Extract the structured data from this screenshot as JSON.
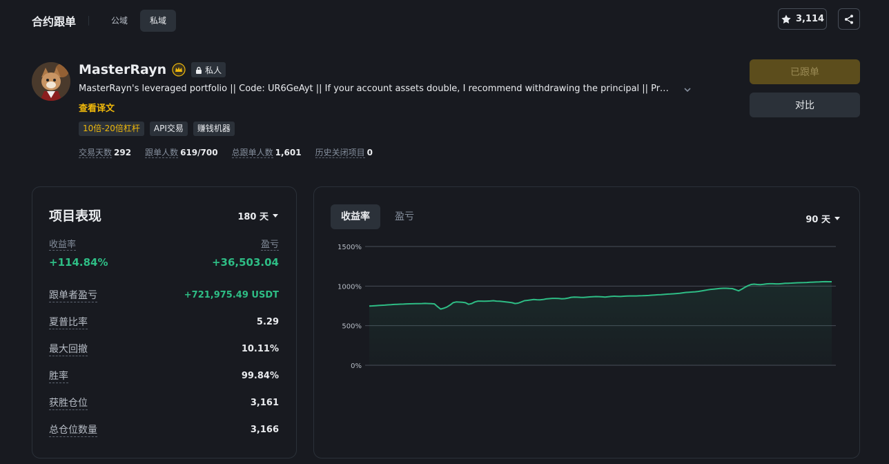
{
  "header": {
    "title": "合约跟单",
    "tabs": [
      {
        "label": "公域",
        "active": false
      },
      {
        "label": "私域",
        "active": true
      }
    ],
    "favorite_count": "3,114"
  },
  "profile": {
    "name": "MasterRayn",
    "private_label": "私人",
    "description": "MasterRayn's leveraged portfolio || Code: UR6GeAyt || If your account assets double, I recommend withdrawing the principal || Profile: ...",
    "translate_link": "查看译文",
    "tags": [
      "10倍-20倍杠杆",
      "API交易",
      "赚钱机器"
    ],
    "stats": [
      {
        "label": "交易天数",
        "value": "292"
      },
      {
        "label": "跟单人数",
        "value": "619/700"
      },
      {
        "label": "总跟单人数",
        "value": "1,601"
      },
      {
        "label": "历史关闭项目",
        "value": "0"
      }
    ],
    "follow_button": "已跟单",
    "compare_button": "对比"
  },
  "performance": {
    "title": "项目表现",
    "period": "180 天",
    "roi_label": "收益率",
    "roi_value": "+114.84%",
    "pnl_label": "盈亏",
    "pnl_value": "+36,503.04",
    "rows": [
      {
        "label": "跟单者盈亏",
        "value": "+721,975.49 USDT"
      },
      {
        "label": "夏普比率",
        "value": "5.29"
      },
      {
        "label": "最大回撤",
        "value": "10.11%"
      },
      {
        "label": "胜率",
        "value": "99.84%"
      },
      {
        "label": "获胜仓位",
        "value": "3,161"
      },
      {
        "label": "总仓位数量",
        "value": "3,166"
      }
    ]
  },
  "chart_panel": {
    "tabs": [
      {
        "label": "收益率",
        "active": true
      },
      {
        "label": "盈亏",
        "active": false
      }
    ],
    "period": "90 天"
  },
  "chart_data": {
    "type": "area",
    "title": "",
    "xlabel": "",
    "ylabel": "",
    "ylim": [
      0,
      1500
    ],
    "yticks": [
      1500,
      1000,
      500,
      0
    ],
    "ytick_labels": [
      "1500%",
      "1000%",
      "500%",
      "0%"
    ],
    "grid": true,
    "series": [
      {
        "values": [
          748,
          750,
          753,
          755,
          758,
          760,
          763,
          765,
          768,
          770,
          772,
          773,
          775,
          776,
          777,
          778,
          779,
          780,
          781,
          780,
          778,
          775,
          740,
          710,
          720,
          735,
          760,
          790,
          800,
          798,
          795,
          790,
          770,
          780,
          800,
          810,
          810,
          808,
          810,
          812,
          815,
          810,
          808,
          805,
          800,
          795,
          790,
          780,
          785,
          800,
          815,
          820,
          825,
          830,
          828,
          826,
          830,
          838,
          842,
          845,
          845,
          843,
          840,
          842,
          848,
          858,
          862,
          860,
          858,
          857,
          860,
          863,
          866,
          868,
          867,
          864,
          862,
          866,
          870,
          872,
          870,
          869,
          872,
          874,
          876,
          876,
          876,
          877,
          878,
          880,
          882,
          885,
          888,
          890,
          892,
          895,
          898,
          900,
          903,
          906,
          910,
          915,
          920,
          923,
          925,
          928,
          932,
          938,
          945,
          952,
          958,
          962,
          966,
          970,
          972,
          972,
          970,
          968,
          955,
          940,
          960,
          985,
          1005,
          1020,
          1025,
          1020,
          1018,
          1022,
          1028,
          1030,
          1030,
          1028,
          1028,
          1032,
          1035,
          1036,
          1038,
          1040,
          1042,
          1043,
          1044,
          1046,
          1048,
          1050,
          1052,
          1053,
          1055,
          1056,
          1055,
          1055
        ]
      }
    ],
    "line_color": "#2ebd85"
  }
}
